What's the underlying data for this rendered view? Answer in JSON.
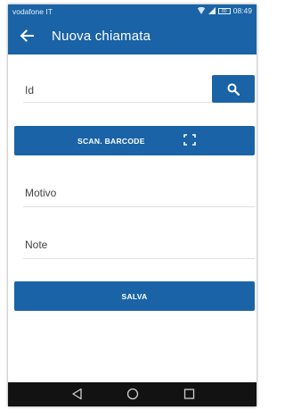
{
  "status_bar": {
    "carrier": "vodafone IT",
    "battery": "80",
    "time": "08:49",
    "icons": [
      "wifi-icon",
      "signal-icon",
      "battery-icon"
    ]
  },
  "app_bar": {
    "title": "Nuova chiamata",
    "back_icon": "arrow-left-icon"
  },
  "form": {
    "id_placeholder": "Id",
    "search_icon": "search-icon",
    "scan_label": "SCAN. BARCODE",
    "scan_icon": "scan-frame-icon",
    "motivo_placeholder": "Motivo",
    "note_placeholder": "Note",
    "save_label": "SALVA"
  },
  "nav_bar": {
    "items": [
      "back-triangle-icon",
      "home-circle-icon",
      "recents-square-icon"
    ]
  },
  "colors": {
    "primary": "#1a63a6",
    "nav_background": "#121212",
    "text": "#444444",
    "divider": "#e0e0e0"
  }
}
